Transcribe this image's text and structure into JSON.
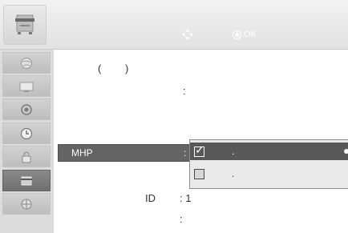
{
  "header": {
    "icon": "tv-menu-icon",
    "hint_move": "◆",
    "hint_sep": ".",
    "hint_ok": "OK"
  },
  "sidebar": {
    "items": [
      {
        "icon": "globe-icon"
      },
      {
        "icon": "picture-icon"
      },
      {
        "icon": "audio-icon"
      },
      {
        "icon": "clock-icon"
      },
      {
        "icon": "lock-icon"
      },
      {
        "icon": "option-icon",
        "active": true
      },
      {
        "icon": "network-icon"
      }
    ]
  },
  "content": {
    "paren_open": "(",
    "paren_close": ")",
    "colon_1": ":",
    "mhp_label": "MHP",
    "mhp_colon": ":",
    "id_label": "ID",
    "id_value": ": 1",
    "colon_last": ":"
  },
  "dropdown": {
    "options": [
      {
        "label": ".",
        "selected": true
      },
      {
        "label": ".",
        "selected": false
      }
    ],
    "selected_color": "#585858"
  }
}
